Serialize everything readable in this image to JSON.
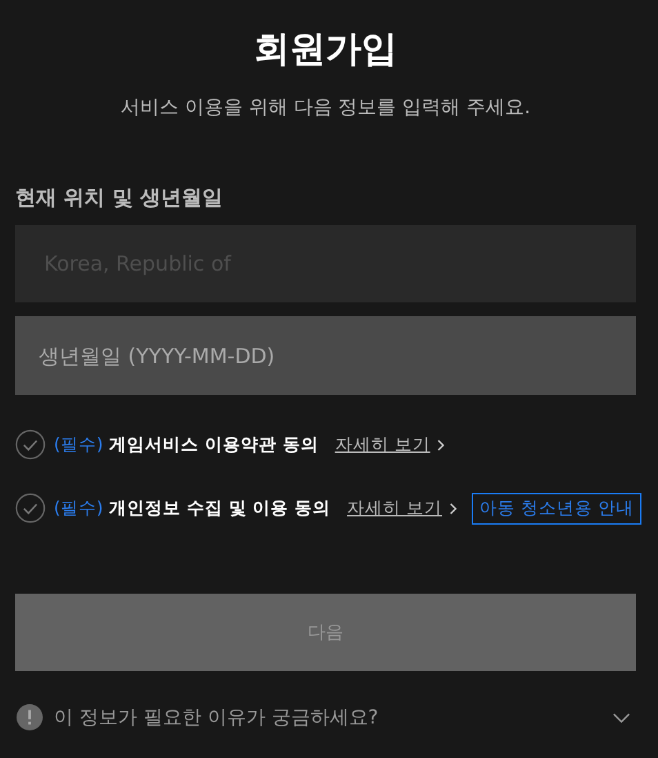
{
  "title": "회원가입",
  "subtitle": "서비스 이용을 위해 다음 정보를 입력해 주세요.",
  "section_label": "현재 위치 및 생년월일",
  "country_field": {
    "value": "Korea, Republic of",
    "disabled": true
  },
  "birthdate_field": {
    "placeholder": "생년월일 (YYYY-MM-DD)"
  },
  "agreements": [
    {
      "required_tag": "(필수)",
      "label": "게임서비스 이용약관 동의",
      "checked": false,
      "link": "자세히 보기"
    },
    {
      "required_tag": "(필수)",
      "label": "개인정보 수집 및 이용 동의",
      "checked": false,
      "link": "자세히 보기",
      "extra_button": "아동 청소년용 안내"
    }
  ],
  "next_button": {
    "label": "다음",
    "disabled": true
  },
  "info": {
    "text": "이 정보가 필요한 이유가 궁금하세요?",
    "expanded": false
  }
}
